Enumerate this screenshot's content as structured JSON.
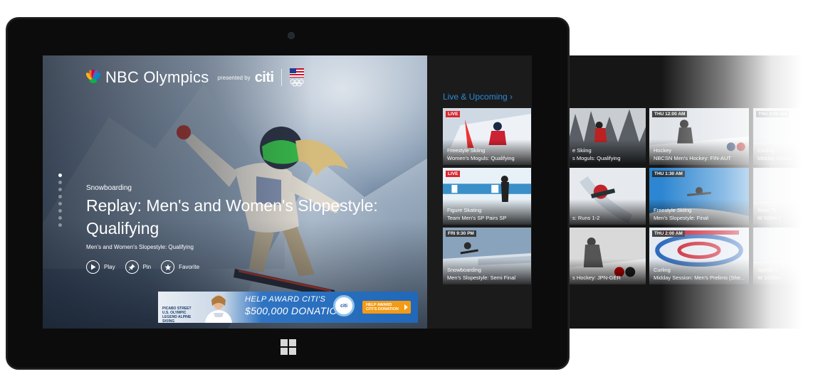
{
  "app": {
    "brand_name": "NBC Olympics",
    "presented_by": "presented by",
    "sponsor": "citi"
  },
  "hero": {
    "sport": "Snowboarding",
    "title": "Replay: Men's and Women's Slopestyle: Qualifying",
    "subtitle": "Men's and Women's Slopestyle: Qualifying",
    "pager_total": 8,
    "pager_active": 0,
    "actions": [
      {
        "label": "Play",
        "icon": "play-icon"
      },
      {
        "label": "Pin",
        "icon": "pin-icon"
      },
      {
        "label": "Favorite",
        "icon": "star-icon"
      }
    ]
  },
  "ad": {
    "person_name": "PICABO STREET",
    "person_sub": "U.S. OLYMPIC LEGEND ALPINE SKIING",
    "headline_1": "HELP AWARD CITI'S",
    "headline_2": "$500,000 DONATION",
    "cta": "HELP AWARD CITI'S DONATION"
  },
  "live_upcoming": {
    "heading": "Live & Upcoming ›",
    "tiles": [
      {
        "badge": "LIVE",
        "badge_type": "live",
        "sport": "Freestyle Skiing",
        "event": "Women's Moguls: Qualifying",
        "scene": "skier"
      },
      {
        "badge": "LIVE",
        "badge_type": "live",
        "sport": "Figure Skating",
        "event": "Team Men's SP Pairs SP",
        "scene": "ice"
      },
      {
        "badge": "FRI 9:30 PM",
        "badge_type": "time",
        "sport": "Snowboarding",
        "event": "Men's Slopestyle: Semi Final",
        "scene": "snow"
      }
    ]
  },
  "more_tiles": {
    "columns": [
      [
        {
          "badge": "",
          "sport": "e Skiing",
          "event": "s Moguls: Qualifying",
          "scene": "forest"
        },
        {
          "badge": "",
          "sport": "",
          "event": "s: Runs 1-2",
          "scene": "luge"
        },
        {
          "badge": "",
          "sport": "",
          "event": "s Hockey: JPN-GER",
          "scene": "hockeybw"
        }
      ],
      [
        {
          "badge": "THU 12:00 AM",
          "sport": "Hockey",
          "event": "NBCSN Men's Hockey: FIN-AUT",
          "scene": "hockey"
        },
        {
          "badge": "THU 1:30 AM",
          "sport": "Freestyle Skiing",
          "event": "Men's Slopestyle: Final",
          "scene": "sky"
        },
        {
          "badge": "THU 2:00 AM",
          "sport": "Curling",
          "event": "Midday Session: Men's Prelims (She...",
          "scene": "curling"
        }
      ],
      [
        {
          "badge": "THU 2:00 AM",
          "sport": "Curling",
          "event": "Midday Sessio",
          "scene": "bright"
        },
        {
          "badge": "",
          "sport": "Short Tr",
          "event": "W 500m (",
          "scene": "bright"
        },
        {
          "badge": "",
          "sport": "Speed S",
          "event": "W 1000m",
          "scene": "bright"
        }
      ]
    ]
  }
}
